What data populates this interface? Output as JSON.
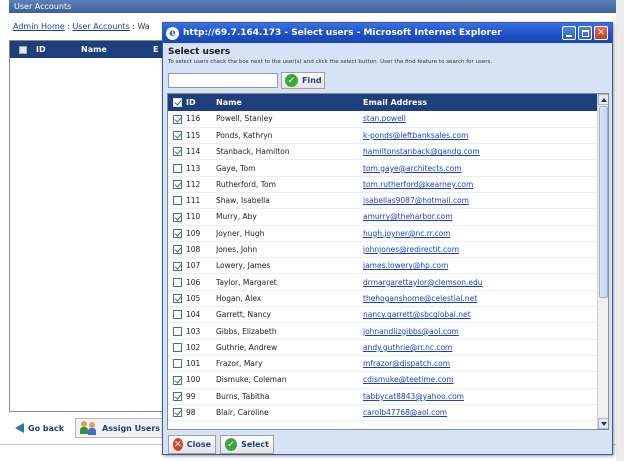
{
  "background": {
    "title": "User Accounts",
    "breadcrumb": {
      "home": "Admin Home",
      "separator": " : ",
      "current_link": "User Accounts",
      "tail": " : Wa"
    },
    "table_header": {
      "id": "ID",
      "name": "Name",
      "partial": "E"
    },
    "footer": {
      "back_label": "Go back",
      "assign_label": "Assign Users"
    }
  },
  "popup": {
    "window_title": "http://69.7.164.173 - Select users - Microsoft Internet Explorer",
    "heading": "Select users",
    "instructions": "To select users check the box next to the user(s) and click the select button. User the find feature to search for users.",
    "search": {
      "value": ""
    },
    "find_label": "Find",
    "table": {
      "columns": [
        "ID",
        "Name",
        "Email Address"
      ],
      "rows": [
        {
          "checked": true,
          "id": "116",
          "name": "Powell, Stanley",
          "email": "stan.powell"
        },
        {
          "checked": true,
          "id": "115",
          "name": "Ponds, Kathryn",
          "email": "k-ponds@leftbanksales.com"
        },
        {
          "checked": true,
          "id": "114",
          "name": "Stanback, Hamilton",
          "email": "hamiltonstanback@gandg.com"
        },
        {
          "checked": false,
          "id": "113",
          "name": "Gaye, Tom",
          "email": "tom.gaye@architects.com"
        },
        {
          "checked": true,
          "id": "112",
          "name": "Rutherford, Tom",
          "email": "tom.rutherford@kearney.com"
        },
        {
          "checked": false,
          "id": "111",
          "name": "Shaw, Isabella",
          "email": "isabellas9087@hotmail.com"
        },
        {
          "checked": true,
          "id": "110",
          "name": "Murry, Aby",
          "email": "amurry@theharbor.com"
        },
        {
          "checked": true,
          "id": "109",
          "name": "Joyner, Hugh",
          "email": "hugh.joyner@nc.rr.com"
        },
        {
          "checked": true,
          "id": "108",
          "name": "Jones, John",
          "email": "johnjones@redirectit.com"
        },
        {
          "checked": true,
          "id": "107",
          "name": "Lowery, James",
          "email": "james.lowery@hp.com"
        },
        {
          "checked": false,
          "id": "106",
          "name": "Taylor, Margaret",
          "email": "drmargarettaylor@clemson.edu"
        },
        {
          "checked": true,
          "id": "105",
          "name": "Hogan, Alex",
          "email": "thehoganshome@celestial.net"
        },
        {
          "checked": false,
          "id": "104",
          "name": "Garrett, Nancy",
          "email": "nancy.garrett@sbcglobal.net"
        },
        {
          "checked": false,
          "id": "103",
          "name": "Gibbs, Elizabeth",
          "email": "johnandlizgibbs@aol.com"
        },
        {
          "checked": false,
          "id": "102",
          "name": "Guthrie, Andrew",
          "email": "andy.guthrie@rr.nc.com"
        },
        {
          "checked": false,
          "id": "101",
          "name": "Frazor, Mary",
          "email": "mfrazor@dispatch.com"
        },
        {
          "checked": true,
          "id": "100",
          "name": "Dismuke, Coleman",
          "email": "cdismuke@teetime.com"
        },
        {
          "checked": true,
          "id": "99",
          "name": "Burns, Tabitha",
          "email": "tabbycat8843@yahoo.com"
        },
        {
          "checked": true,
          "id": "98",
          "name": "Blair, Caroline",
          "email": "carolb47768@aol.com"
        }
      ]
    },
    "close_label": "Close",
    "select_label": "Select"
  },
  "colors": {
    "header_navy": "#1d3f7d",
    "link_blue": "#1a3fc0",
    "title_bar_blue": "#1c4fc6",
    "popup_bg": "#d6e3f7"
  },
  "icons": {
    "find": "check-circle-icon",
    "select": "check-circle-icon",
    "close": "x-circle-icon",
    "back": "arrow-left-icon",
    "assign": "users-icon",
    "browser": "ie-logo-icon"
  }
}
